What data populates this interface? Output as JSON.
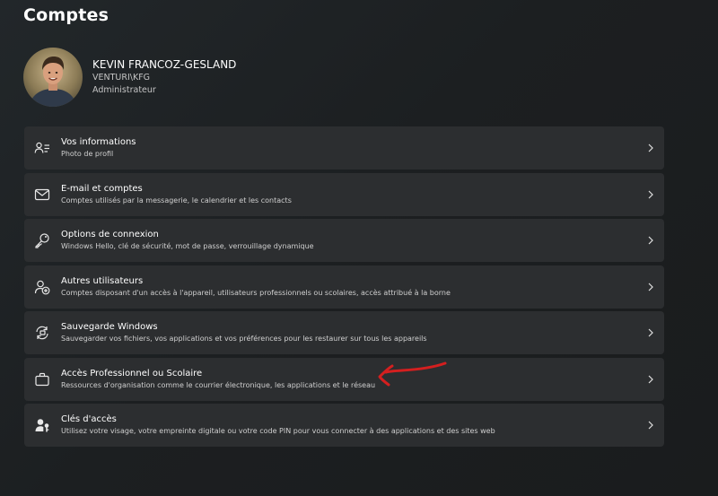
{
  "page": {
    "title": "Comptes"
  },
  "profile": {
    "name": "KEVIN FRANCOZ-GESLAND",
    "account": "VENTURI\\KFG",
    "role": "Administrateur"
  },
  "settings": [
    {
      "title": "Vos informations",
      "description": "Photo de profil",
      "icon": "person-info-icon"
    },
    {
      "title": "E-mail et comptes",
      "description": "Comptes utilisés par la messagerie, le calendrier et les contacts",
      "icon": "mail-icon"
    },
    {
      "title": "Options de connexion",
      "description": "Windows Hello, clé de sécurité, mot de passe, verrouillage dynamique",
      "icon": "key-icon"
    },
    {
      "title": "Autres utilisateurs",
      "description": "Comptes disposant d'un accès à l'appareil, utilisateurs professionnels ou scolaires, accès attribué à la borne",
      "icon": "person-add-icon"
    },
    {
      "title": "Sauvegarde Windows",
      "description": "Sauvegarder vos fichiers, vos applications et vos préférences pour les restaurer sur tous les appareils",
      "icon": "backup-sync-icon"
    },
    {
      "title": "Accès Professionnel ou Scolaire",
      "description": "Ressources d'organisation comme le courrier électronique, les applications et le réseau",
      "icon": "briefcase-icon"
    },
    {
      "title": "Clés d'accès",
      "description": "Utilisez votre visage, votre empreinte digitale ou votre code PIN pour vous connecter à des applications et des sites web",
      "icon": "person-key-icon"
    }
  ],
  "colors": {
    "background": "#1d2022",
    "card": "#2c2e30",
    "annotation": "#d41f1f"
  }
}
